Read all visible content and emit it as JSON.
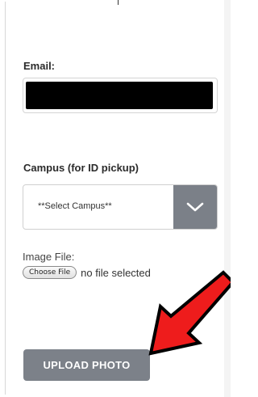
{
  "form": {
    "email_label": "Email:",
    "email_value": "",
    "campus_label": "Campus (for ID pickup)",
    "campus_selected": "**Select Campus**",
    "image_label": "Image File:",
    "choose_file_label": "Choose File",
    "file_status": "no file selected",
    "upload_label": "UPLOAD PHOTO"
  },
  "icons": {
    "select_toggle": "chevron-down-icon",
    "annotation": "arrow-icon"
  },
  "colors": {
    "button_gray": "#7b8088",
    "redaction": "#000000",
    "arrow_fill": "#ee1c1c",
    "arrow_stroke": "#000000"
  }
}
